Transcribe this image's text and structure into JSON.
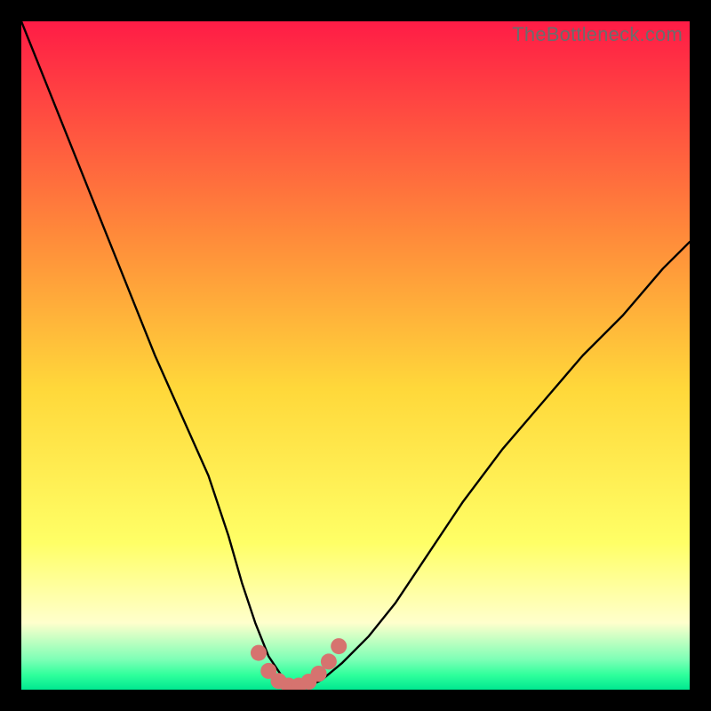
{
  "watermark": "TheBottleneck.com",
  "colors": {
    "grad_top": "#ff1c46",
    "grad_mid_upper": "#ff8a3a",
    "grad_mid": "#ffd83a",
    "grad_lower": "#ffff66",
    "grad_pale": "#ffffcc",
    "grad_green1": "#7dffb6",
    "grad_green2": "#2fff9c",
    "grad_green3": "#00e890",
    "curve": "#000000",
    "marker": "#d6736f"
  },
  "chart_data": {
    "type": "line",
    "title": "",
    "xlabel": "",
    "ylabel": "",
    "xlim": [
      0,
      100
    ],
    "ylim": [
      0,
      100
    ],
    "series": [
      {
        "name": "bottleneck-curve",
        "x": [
          0,
          4,
          8,
          12,
          16,
          20,
          24,
          28,
          31,
          33,
          35,
          37,
          39,
          41,
          43,
          45,
          48,
          52,
          56,
          60,
          66,
          72,
          78,
          84,
          90,
          96,
          100
        ],
        "y": [
          100,
          90,
          80,
          70,
          60,
          50,
          41,
          32,
          23,
          16,
          10,
          5,
          2,
          0.5,
          0.5,
          1.5,
          4,
          8,
          13,
          19,
          28,
          36,
          43,
          50,
          56,
          63,
          67
        ]
      }
    ],
    "markers": {
      "name": "highlight-trough",
      "x": [
        35.5,
        37,
        38.5,
        40,
        41.5,
        43,
        44.5,
        46,
        47.5
      ],
      "y": [
        5.5,
        2.8,
        1.3,
        0.6,
        0.6,
        1.2,
        2.4,
        4.2,
        6.5
      ]
    }
  }
}
